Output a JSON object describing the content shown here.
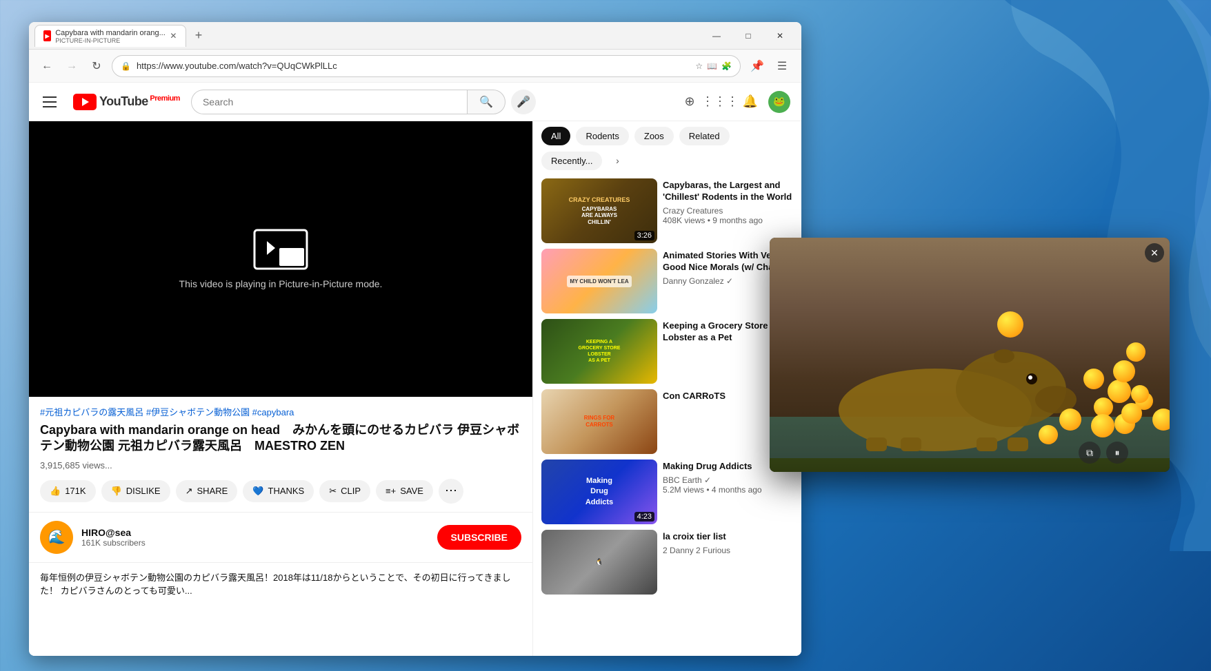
{
  "browser": {
    "tab": {
      "title": "Capybara with mandarin orang...",
      "subtitle": "PICTURE-IN-PICTURE",
      "favicon": "YT"
    },
    "new_tab_label": "+",
    "url": "https://www.youtube.com/watch?v=QUqCWkPlLLc",
    "window_controls": {
      "minimize": "—",
      "maximize": "□",
      "close": "✕"
    },
    "nav": {
      "back": "←",
      "forward": "→",
      "refresh": "↻"
    }
  },
  "youtube": {
    "logo_text": "Premium",
    "search_placeholder": "Search",
    "header_icons": {
      "create": "⊕",
      "apps": "⋮⋮",
      "notifications": "🔔",
      "avatar": "🐸"
    },
    "filter_chips": [
      {
        "label": "All",
        "active": true
      },
      {
        "label": "Rodents",
        "active": false
      },
      {
        "label": "Zoos",
        "active": false
      },
      {
        "label": "Related",
        "active": false
      },
      {
        "label": "Recently...",
        "active": false
      }
    ],
    "video": {
      "tags": "#元祖カピバラの露天風呂 #伊豆シャボテン動物公園 #capybara",
      "title": "Capybara with mandarin orange on head　みかんを頭にのせるカピバラ 伊豆シャボテン動物公園 元祖カピバラ露天風呂　MAESTRO ZEN",
      "views": "3,915,685 views...",
      "likes": "171K",
      "pip_text": "This video is playing in Picture-in-Picture mode.",
      "actions": {
        "like": "👍 171K",
        "dislike": "DISLIKE",
        "share": "SHARE",
        "thanks": "THANKS",
        "clip": "CLIP",
        "save": "+ SAVE"
      }
    },
    "channel": {
      "name": "HIRO@sea",
      "subscribers": "161K subscribers",
      "subscribe_label": "SUBSCRIBE"
    },
    "description": "毎年恒例の伊豆シャボテン動物公園のカピバラ露天風呂！2018年は11/18からということで、その初日に行ってきました！\nカピバラさんのとっても可愛い...",
    "related_videos": [
      {
        "thumb_class": "thumb-capybara",
        "thumb_text": "CAPYBARAS ARE ALWAYS CHILLIN'",
        "thumb_label": "CRAZY CREATURES",
        "duration": "3:26",
        "title": "Capybaras, the Largest and 'Chillest' Rodents in the World",
        "channel": "Crazy Creatures",
        "verified": false,
        "views": "408K views",
        "time_ago": "9 months ago"
      },
      {
        "thumb_class": "thumb-animated",
        "thumb_text": "MY CHILD WON'T LEA",
        "thumb_label": "",
        "duration": "",
        "title": "Animated Stories With Very Good Nice Morals (w/ Chad…",
        "channel": "Danny Gonzalez",
        "verified": true,
        "views": "",
        "time_ago": ""
      },
      {
        "thumb_class": "thumb-grocery",
        "thumb_text": "KEEPING A GROCERY STORE LOBSTER AS A PET",
        "thumb_label": "",
        "duration": "",
        "title": "Keeping a Grocery Store Lobster as a Pet",
        "channel": "",
        "verified": false,
        "views": "",
        "time_ago": ""
      },
      {
        "thumb_class": "thumb-rabbit",
        "thumb_text": "RINGS FOR CARROTS",
        "thumb_label": "",
        "duration": "",
        "title": "Con CARRoTS",
        "channel": "",
        "verified": false,
        "views": "",
        "time_ago": ""
      },
      {
        "thumb_class": "thumb-making",
        "thumb_text": "Making Drug Addicts",
        "thumb_label": "",
        "duration": "",
        "title": "Making Drug Addicts",
        "channel": "BBC Earth",
        "verified": true,
        "views": "5.2M views",
        "time_ago": "4 months ago",
        "duration_shown": "4:23"
      },
      {
        "thumb_class": "thumb-penguin",
        "thumb_text": "",
        "thumb_label": "",
        "duration": "",
        "title": "la croix tier list",
        "channel": "2 Danny 2 Furious",
        "verified": false,
        "views": "",
        "time_ago": ""
      }
    ],
    "pip_window": {
      "close_label": "✕",
      "pause_label": "⏸",
      "pip_label": "⧉"
    }
  }
}
